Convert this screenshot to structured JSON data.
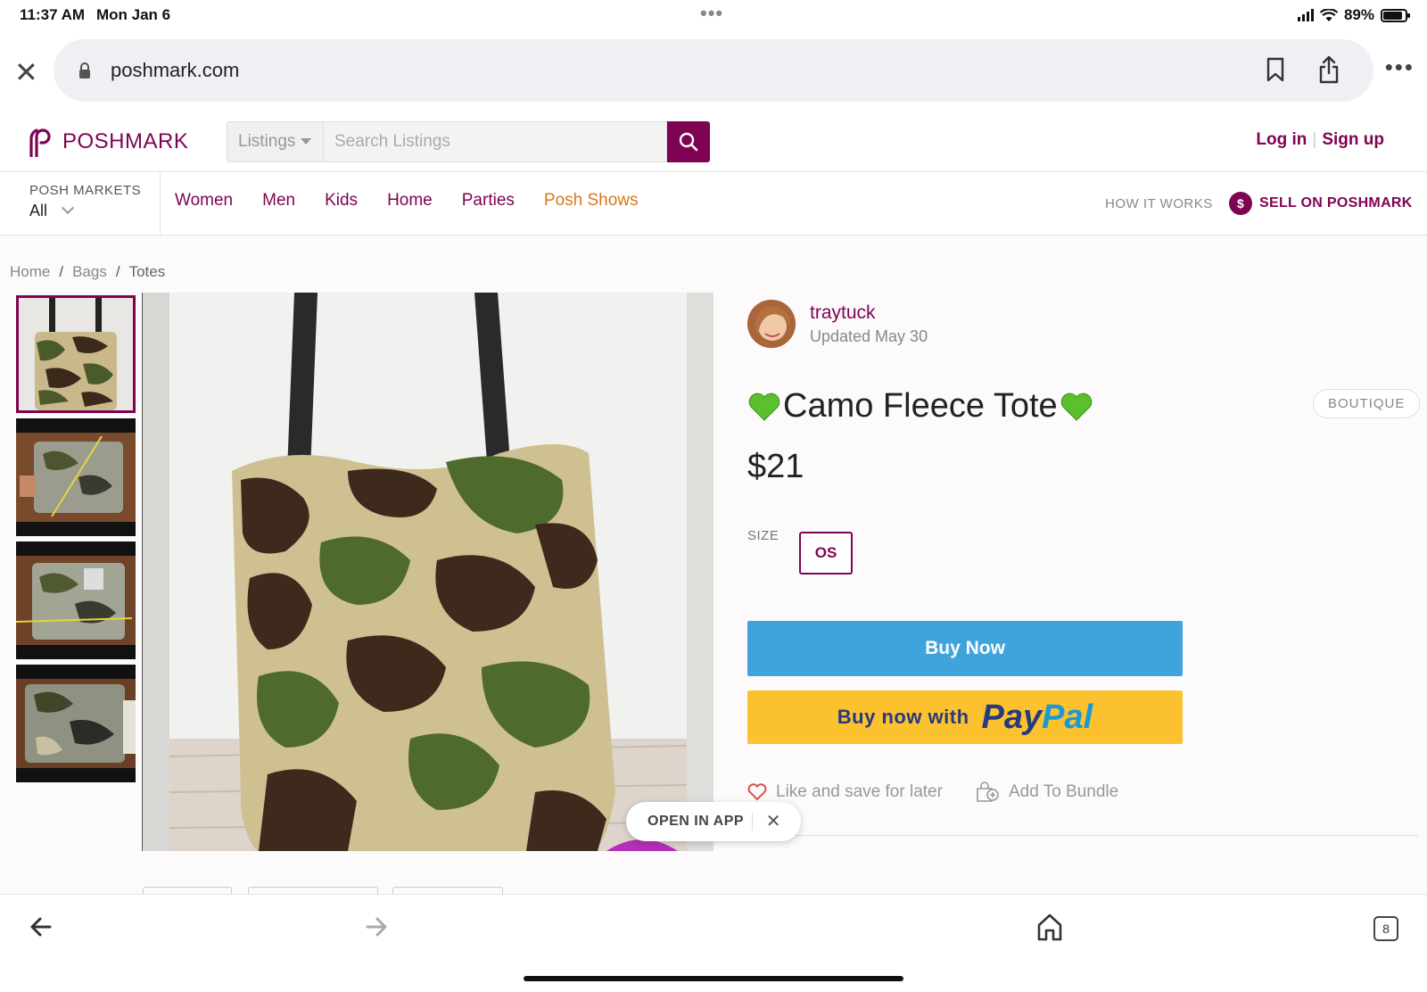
{
  "status": {
    "time": "11:37 AM",
    "date": "Mon Jan 6",
    "battery": "89%",
    "battery_level": 0.89
  },
  "browser": {
    "url": "poshmark.com",
    "tab_count": "8"
  },
  "header": {
    "logo_text": "POSHMARK",
    "search_category": "Listings",
    "search_placeholder": "Search Listings",
    "login": "Log in",
    "signup": "Sign up"
  },
  "nav": {
    "markets_label": "POSH MARKETS",
    "markets_value": "All",
    "links": [
      "Women",
      "Men",
      "Kids",
      "Home",
      "Parties",
      "Posh Shows"
    ],
    "how_it_works": "HOW IT WORKS",
    "sell": "SELL ON POSHMARK",
    "sell_coin": "$"
  },
  "breadcrumb": [
    "Home",
    "Bags",
    "Totes"
  ],
  "listing": {
    "seller": "traytuck",
    "updated": "Updated May 30",
    "title": "Camo Fleece Tote",
    "badge": "BOUTIQUE",
    "price": "$21",
    "size_label": "SIZE",
    "size": "OS",
    "buy_now": "Buy Now",
    "paypal_prefix": "Buy now with",
    "paypal_a": "Pay",
    "paypal_b": "Pal",
    "like": "Like and save for later",
    "bundle": "Add To Bundle",
    "open_in_app": "OPEN IN APP"
  },
  "colors": {
    "brand": "#7f0353",
    "buy": "#40a4dc",
    "paypal": "#fcc12f",
    "shows": "#d9771d"
  }
}
